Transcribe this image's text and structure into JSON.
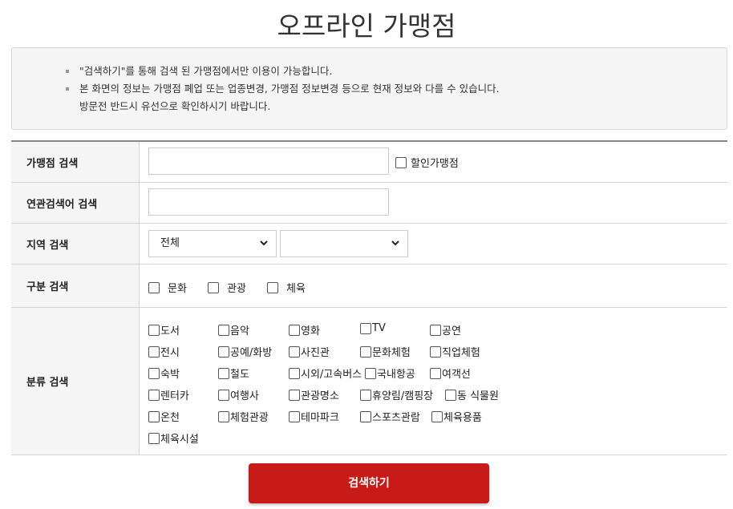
{
  "page": {
    "title": "오프라인 가맹점"
  },
  "notice": {
    "lines": [
      "\"검색하기\"를 통해 검색 된 가맹점에서만 이용이 가능합니다.",
      "본 화면의 정보는 가맹점 폐업 또는 업종변경, 가맹점 정보변경 등으로 현재 정보와 다를 수 있습니다.",
      "방문전 반드시 유선으로 확인하시기 바랍니다."
    ]
  },
  "form": {
    "store_search": {
      "label": "가맹점 검색",
      "value": "",
      "discount_checkbox_label": "할인가맹점",
      "discount_checked": false
    },
    "keyword_search": {
      "label": "연관검색어 검색",
      "value": ""
    },
    "region_search": {
      "label": "지역 검색",
      "region1_value": "전체",
      "region2_value": ""
    },
    "type_search": {
      "label": "구분 검색",
      "options": [
        "문화",
        "관광",
        "체육"
      ]
    },
    "category_search": {
      "label": "분류 검색",
      "options": [
        "도서",
        "음악",
        "영화",
        "TV",
        "공연",
        "전시",
        "공예/화방",
        "사진관",
        "문화체험",
        "직업체험",
        "숙박",
        "철도",
        "시외/고속버스",
        "국내항공",
        "여객선",
        "렌터카",
        "여행사",
        "관광명소",
        "휴양림/캠핑장",
        "동 식물원",
        "온천",
        "체험관광",
        "테마파크",
        "스포츠관람",
        "체육용품",
        "체육시설"
      ]
    }
  },
  "actions": {
    "search_button_label": "검색하기"
  },
  "colors": {
    "accent": "#c81a17",
    "label_bg": "#f5f5f5",
    "notice_bg": "#f5f5f5"
  }
}
